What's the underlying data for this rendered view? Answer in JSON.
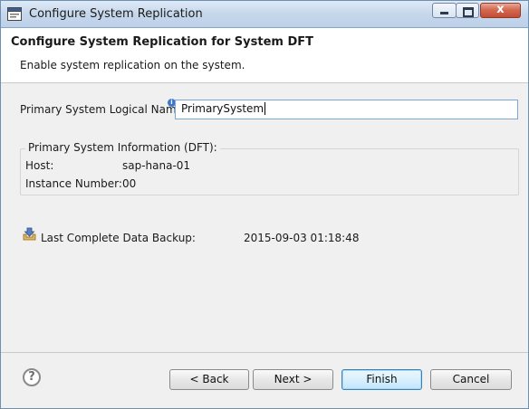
{
  "window": {
    "title": "Configure System Replication"
  },
  "title_buttons": {
    "close_label": "x"
  },
  "header": {
    "title": "Configure System Replication for System DFT",
    "description": "Enable system replication on the system."
  },
  "form": {
    "primary_name_label": "Primary System Logical Name:",
    "primary_name_value": "PrimarySystem",
    "info_marker": "i"
  },
  "primary_info": {
    "title": "Primary System Information (DFT):",
    "host_label": "Host:",
    "host_value": "sap-hana-01",
    "instance_label": "Instance Number:",
    "instance_value": "00"
  },
  "backup": {
    "label": "Last Complete Data Backup:",
    "value": "2015-09-03 01:18:48"
  },
  "footer": {
    "help_symbol": "?",
    "back_label": "< Back",
    "next_label": "Next >",
    "finish_label": "Finish",
    "cancel_label": "Cancel"
  },
  "icons": {
    "app": "eclipse-window-icon",
    "backup": "backup-download-icon",
    "help": "help-question-icon",
    "info": "info-icon"
  },
  "colors": {
    "titlebar": "#c6d7ec",
    "close_button": "#c44a33",
    "default_button_border": "#3c7fb1",
    "input_border": "#7aa7d6"
  }
}
